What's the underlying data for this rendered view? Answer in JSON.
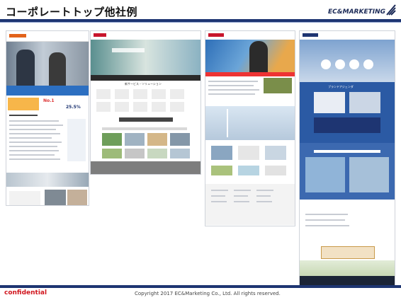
{
  "slide": {
    "title": "コーポレートトップ他社例",
    "logo_text": "EC&MARKETING",
    "footer_confidential": "confidential",
    "footer_copyright": "Copyright  2017  EC&Marketing Co., Ltd.  All rights reserved."
  },
  "screenshots": {
    "site1": {
      "headline_number": "No.1",
      "score": "25.5%"
    },
    "site2": {
      "banner_text": "新サービス・ソリューション"
    },
    "site4": {
      "hero_text": "ブランドアジェンダ"
    }
  },
  "colors": {
    "accent": "#1e3572",
    "confidential": "#d0161e"
  }
}
